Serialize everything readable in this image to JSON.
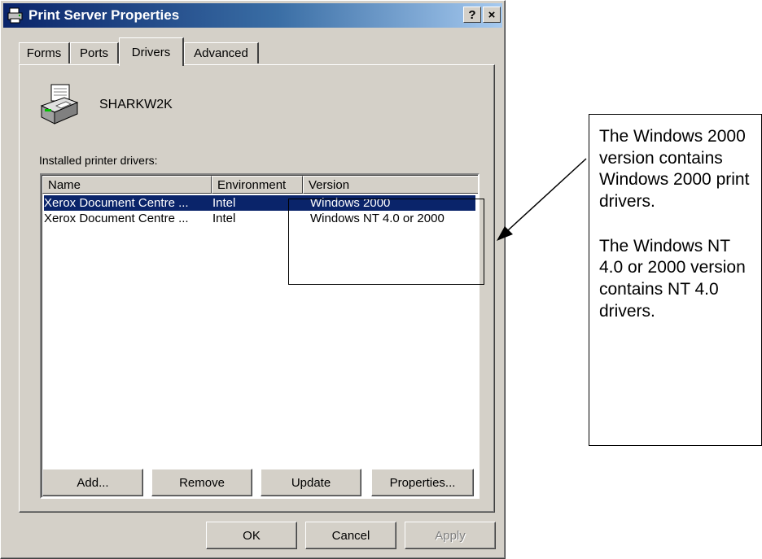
{
  "window": {
    "title": "Print Server Properties",
    "help_button": "?",
    "close_button": "×"
  },
  "tabs": [
    {
      "label": "Forms"
    },
    {
      "label": "Ports"
    },
    {
      "label": "Drivers"
    },
    {
      "label": "Advanced"
    }
  ],
  "active_tab": "Drivers",
  "server": {
    "name": "SHARKW2K"
  },
  "drivers": {
    "label": "Installed printer drivers:",
    "columns": [
      "Name",
      "Environment",
      "Version"
    ],
    "rows": [
      {
        "name": "Xerox Document Centre ...",
        "environment": "Intel",
        "version": "Windows 2000",
        "selected": true
      },
      {
        "name": "Xerox Document Centre ...",
        "environment": "Intel",
        "version": "Windows NT 4.0 or 2000",
        "selected": false
      }
    ]
  },
  "panel_buttons": {
    "add": "Add...",
    "remove": "Remove",
    "update": "Update",
    "properties": "Properties..."
  },
  "dialog_buttons": {
    "ok": "OK",
    "cancel": "Cancel",
    "apply": "Apply"
  },
  "annotation": {
    "paragraph1": "The Windows 2000 version contains Windows 2000 print drivers.",
    "paragraph2": "The Windows NT 4.0 or 2000 version contains NT 4.0 drivers."
  },
  "colors": {
    "face": "#d4d0c8",
    "title_start": "#0a246a",
    "title_end": "#a6caf0",
    "selection": "#0a246a"
  }
}
